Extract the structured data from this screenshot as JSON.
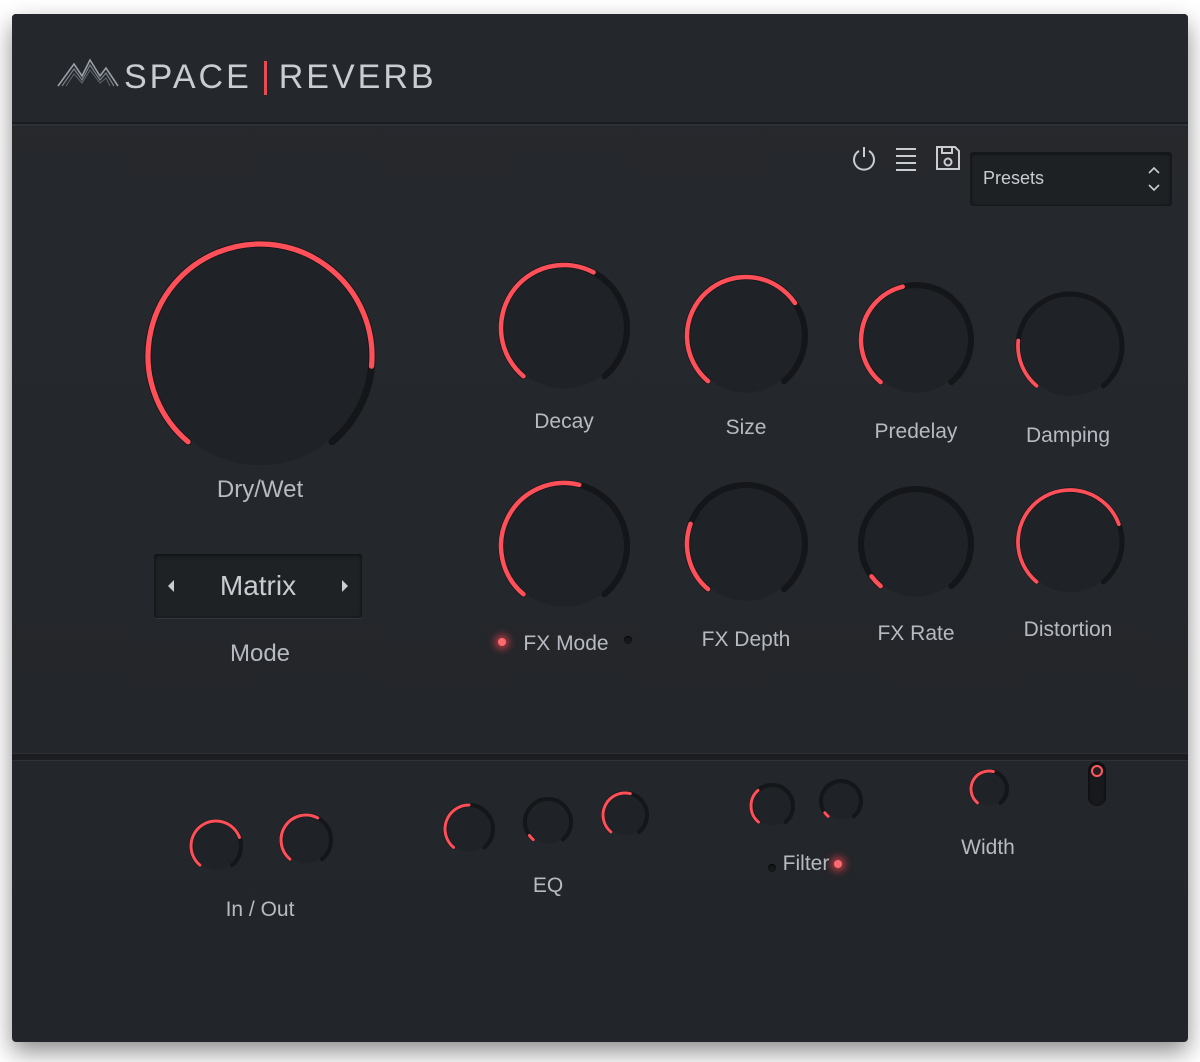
{
  "header": {
    "brand_left": "SPACE",
    "brand_right": "REVERB",
    "presets_label": "Presets"
  },
  "toolbar": {
    "power_icon": "power-icon",
    "menu_icon": "menu-icon",
    "save_icon": "save-icon"
  },
  "colors": {
    "accent": "#ff4f58",
    "track": "#141619",
    "knob_body": "#1f2226",
    "text": "#b7bbc1"
  },
  "main": {
    "drywet": {
      "label": "Dry/Wet",
      "value": 0.84
    },
    "mode": {
      "label": "Mode",
      "value": "Matrix"
    },
    "knobs_row1": [
      {
        "label": "Decay",
        "value": 0.6
      },
      {
        "label": "Size",
        "value": 0.7
      },
      {
        "label": "Predelay",
        "value": 0.45
      },
      {
        "label": "Damping",
        "value": 0.2
      }
    ],
    "knobs_row2": [
      {
        "label": "FX Mode",
        "value": 0.55
      },
      {
        "label": "FX Depth",
        "value": 0.25
      },
      {
        "label": "FX Rate",
        "value": 0.05
      },
      {
        "label": "Distortion",
        "value": 0.75
      }
    ]
  },
  "bottom": {
    "inout": {
      "label": "In / Out",
      "values": [
        0.75,
        0.6
      ]
    },
    "eq": {
      "label": "EQ",
      "values": [
        0.5,
        0.05,
        0.55
      ]
    },
    "filter": {
      "label": "Filter",
      "values": [
        0.35,
        0.05
      ]
    },
    "width": {
      "label": "Width",
      "value": 0.55
    }
  }
}
